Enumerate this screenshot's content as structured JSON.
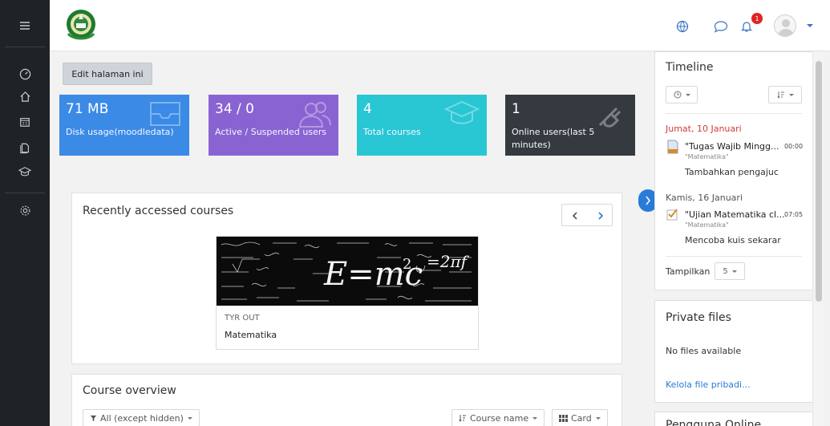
{
  "nav": {
    "rail_icons": [
      "hamburger-icon",
      "dashboard-icon",
      "home-icon",
      "calendar-icon",
      "files-icon",
      "graduation-cap-icon",
      "settings-icon"
    ],
    "topbar_icons": [
      "globe-icon",
      "messages-icon",
      "notifications-bell-icon"
    ],
    "messages_badge": "1"
  },
  "edit_button": "Edit halaman ini",
  "stats": [
    {
      "value": "71 MB",
      "label": "Disk usage(moodledata)",
      "color": "#3b8ae6",
      "icon": "inbox-icon"
    },
    {
      "value": "34 / 0",
      "label": "Active / Suspended users",
      "color": "#8a63d2",
      "icon": "users-icon"
    },
    {
      "value": "4",
      "label": "Total courses",
      "color": "#29c6d4",
      "icon": "graduation-cap-icon"
    },
    {
      "value": "1",
      "label": "Online users(last 5 minutes)",
      "color": "#343a40",
      "icon": "plug-icon"
    }
  ],
  "recent": {
    "title": "Recently accessed courses",
    "course": {
      "category": "TYR OUT",
      "name": "Matematika"
    }
  },
  "overview": {
    "title": "Course overview",
    "filter": "All (except hidden)",
    "sort": "Course name",
    "view": "Card"
  },
  "timeline": {
    "title": "Timeline",
    "groups": [
      {
        "date": "Jumat, 10 Januari",
        "color": "#d13b3b",
        "item": "\"Tugas Wajib Mingg...",
        "time": "00:00",
        "course": "\"Matematika\"",
        "action": "Tambahkan pengajuc"
      },
      {
        "date": "Kamis, 16 Januari",
        "color": "#555555",
        "item": "\"Ujian Matematika cl...",
        "time": "07:05",
        "course": "\"Matematika\"",
        "action": "Mencoba kuis sekarar"
      }
    ],
    "show_label": "Tampilkan",
    "show_value": "5"
  },
  "private_files": {
    "title": "Private files",
    "empty": "No files available",
    "manage_link": "Kelola file pribadi..."
  },
  "next_block_title": "Pengguna Online"
}
